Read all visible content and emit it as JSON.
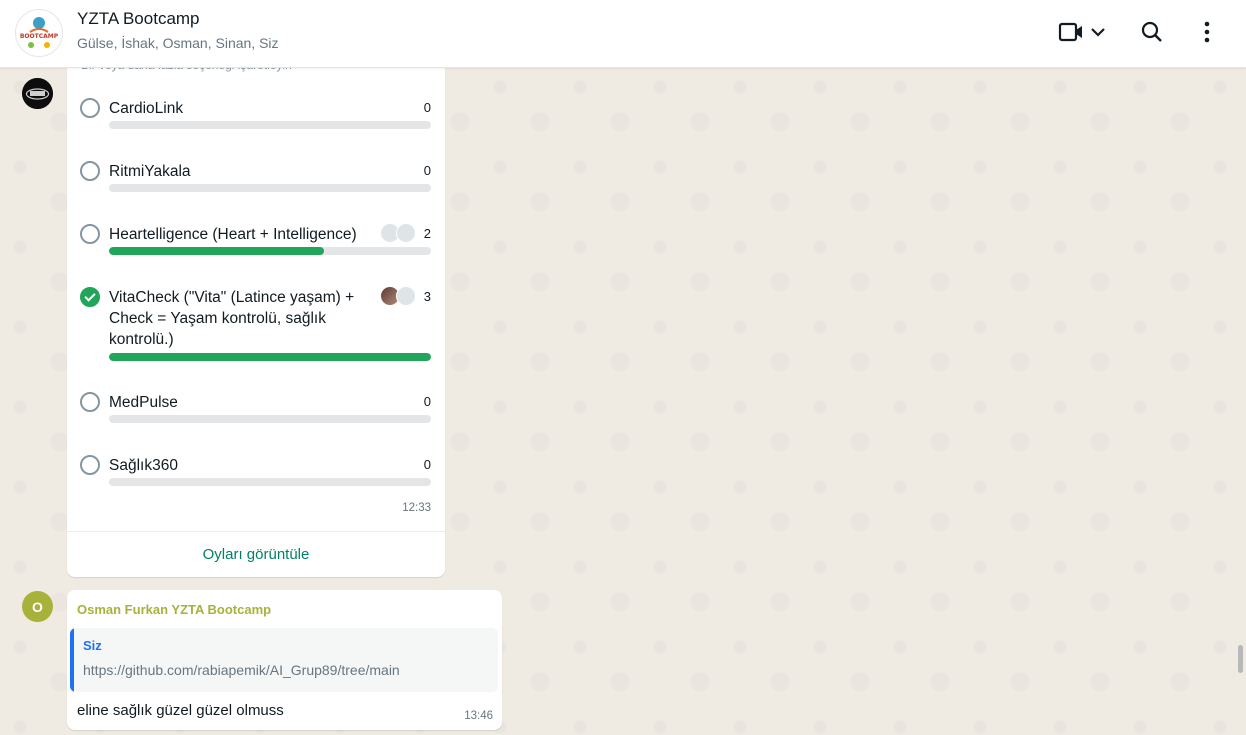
{
  "header": {
    "group_name": "YZTA Bootcamp",
    "members": "Gülse, İshak, Osman, Sinan, Siz",
    "avatar_text": "BOOTCAMP",
    "icons": [
      "video-call-icon",
      "chevron-down-icon",
      "search-icon",
      "menu-icon"
    ]
  },
  "poll": {
    "hint": "Bir veya daha fazla seçeneği işaretleyin",
    "options": [
      {
        "label": "CardioLink",
        "votes": "0",
        "fraction": 0,
        "checked": false
      },
      {
        "label": "RitmiYakala",
        "votes": "0",
        "fraction": 0,
        "checked": false
      },
      {
        "label": "Heartelligence (Heart + Intelligence)",
        "votes": "2",
        "fraction": 0.667,
        "checked": false
      },
      {
        "label": "VitaCheck (\"Vita\" (Latince yaşam) + Check = Yaşam kontrolü, sağlık kontrolü.)",
        "votes": "3",
        "fraction": 1.0,
        "checked": true
      },
      {
        "label": "MedPulse",
        "votes": "0",
        "fraction": 0,
        "checked": false
      },
      {
        "label": "Sağlık360",
        "votes": "0",
        "fraction": 0,
        "checked": false
      }
    ],
    "time": "12:33",
    "view_votes": "Oyları görüntüle"
  },
  "message": {
    "avatar_letter": "O",
    "sender": "Osman Furkan YZTA Bootcamp",
    "quote_author": "Siz",
    "quote_text": "https://github.com/rabiapemik/AI_Grup89/tree/main",
    "text": "eline sağlık güzel güzel olmuss",
    "time": "13:46"
  },
  "colors": {
    "accent": "#21a55a",
    "link_green": "#008069",
    "sender_olive": "#a6b23a",
    "quote_blue": "#1d72f3"
  }
}
